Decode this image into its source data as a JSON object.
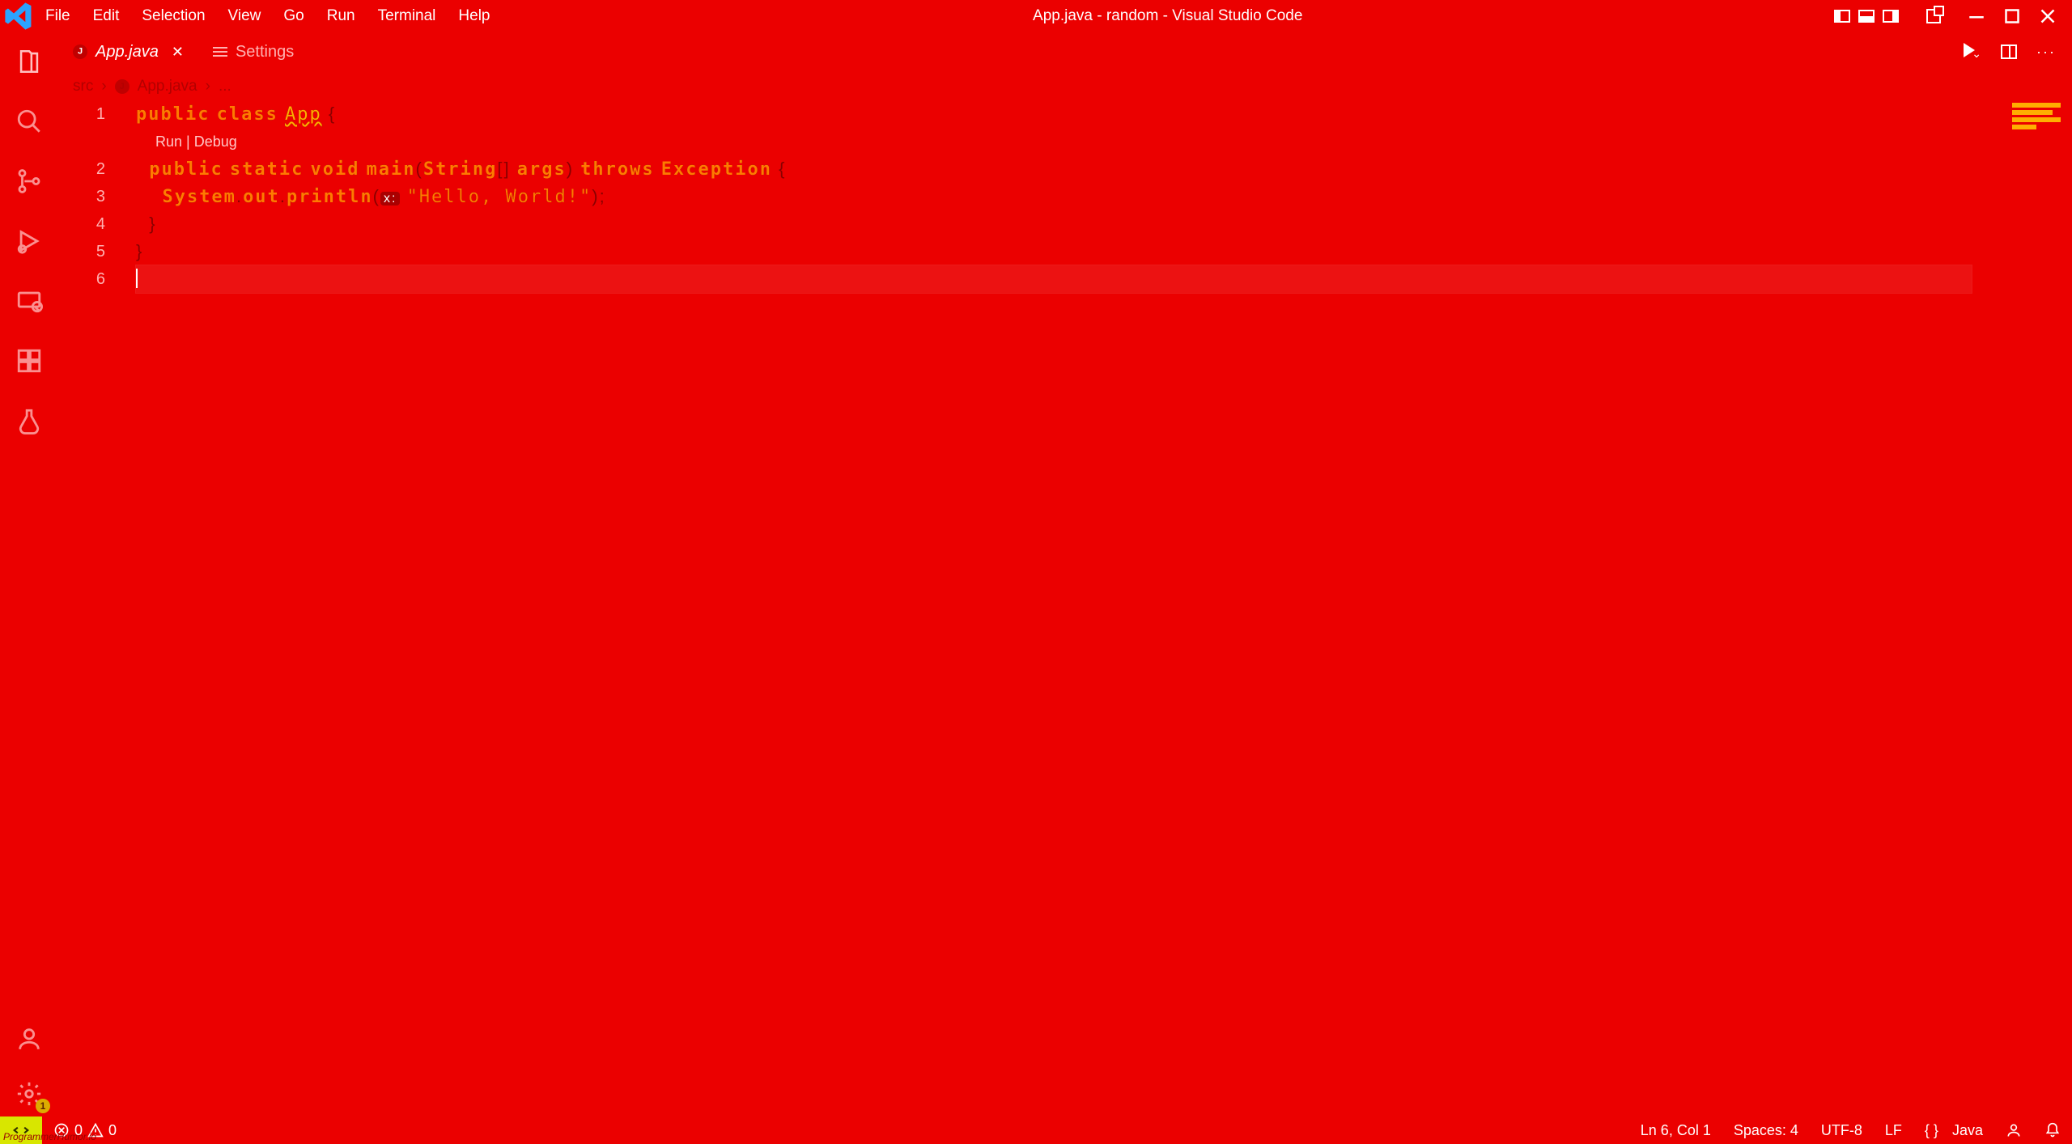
{
  "window_title": "App.java - random - Visual Studio Code",
  "menu": {
    "file": "File",
    "edit": "Edit",
    "selection": "Selection",
    "view": "View",
    "go": "Go",
    "run": "Run",
    "terminal": "Terminal",
    "help": "Help"
  },
  "tabs": {
    "file": {
      "label": "App.java"
    },
    "settings": {
      "label": "Settings"
    }
  },
  "breadcrumb": {
    "root": "src",
    "file": "App.java",
    "dots": "..."
  },
  "codelens": "Run | Debug",
  "code": {
    "line1": {
      "kw1": "public",
      "kw2": "class",
      "cls": "App",
      "brace": "{"
    },
    "line2": {
      "kw1": "public",
      "kw2": "static",
      "kw3": "void",
      "id": "main",
      "p1": "(",
      "ty": "String",
      "br": "[]",
      "arg": "args",
      "p2": ")",
      "kw4": "throws",
      "ex": "Exception",
      "brace": "{"
    },
    "line3": {
      "o1": "System",
      "d1": ".",
      "o2": "out",
      "d2": ".",
      "m": "println",
      "p1": "(",
      "hint": "x:",
      "str": "\"Hello, World!\"",
      "p2": ")",
      "sc": ";"
    },
    "line4": {
      "brace": "}"
    },
    "line5": {
      "brace": "}"
    }
  },
  "line_numbers": [
    "1",
    "2",
    "3",
    "4",
    "5",
    "6"
  ],
  "status": {
    "errors": "0",
    "warnings": "0",
    "ln_col": "Ln 6, Col 1",
    "spaces": "Spaces: 4",
    "encoding": "UTF-8",
    "eol": "LF",
    "lang_braces": "{ }",
    "lang": "Java"
  },
  "badges": {
    "settings": "1"
  },
  "watermark": "ProgrammerHumor.io"
}
